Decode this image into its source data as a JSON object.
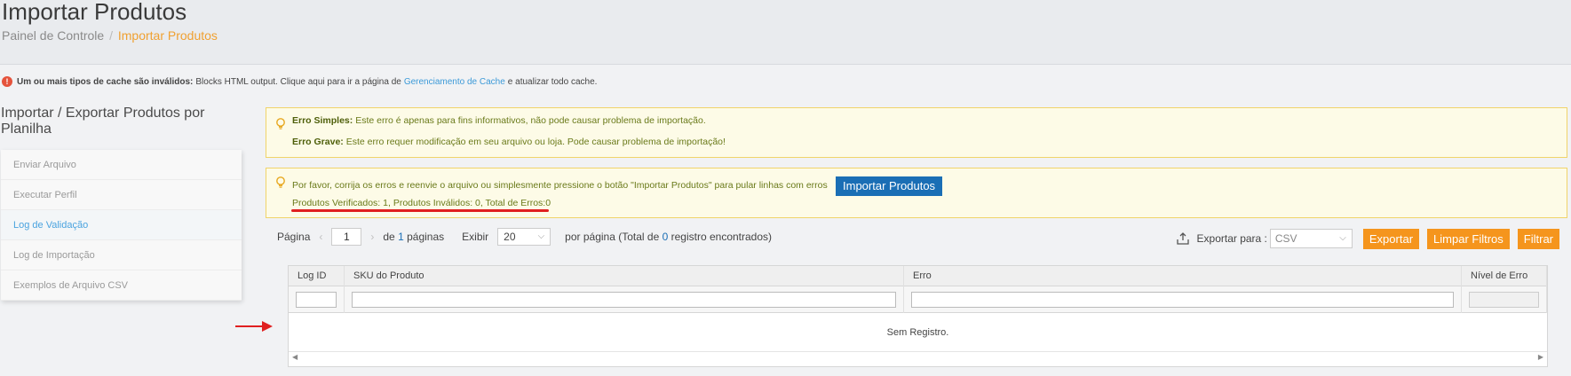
{
  "header": {
    "title": "Importar Produtos",
    "breadcrumb": {
      "home": "Painel de Controle",
      "separator": "/",
      "current": "Importar Produtos"
    }
  },
  "cache_notice": {
    "bold": "Um ou mais tipos de cache são inválidos:",
    "text": "Blocks HTML output. Clique aqui para ir a página de",
    "link": "Gerenciamento de Cache",
    "suffix": "e atualizar todo cache."
  },
  "sidebar": {
    "title": "Importar / Exportar Produtos por Planilha",
    "items": [
      {
        "label": "Enviar Arquivo"
      },
      {
        "label": "Executar Perfil"
      },
      {
        "label": "Log de Validação",
        "active": true
      },
      {
        "label": "Log de Importação"
      },
      {
        "label": "Exemplos de Arquivo CSV"
      }
    ]
  },
  "notice_errors": {
    "simple_label": "Erro Simples:",
    "simple_text": "Este erro é apenas para fins informativos, não pode causar problema de importação.",
    "grave_label": "Erro Grave:",
    "grave_text": "Este erro requer modificação em seu arquivo ou loja. Pode causar problema de importação!"
  },
  "notice_action": {
    "text": "Por favor, corrija os erros e reenvie o arquivo ou simplesmente pressione o botão \"Importar Produtos\" para pular linhas com erros",
    "button": "Importar Produtos",
    "summary": "Produtos Verificados: 1, Produtos Inválidos: 0, Total de Erros:0"
  },
  "pager": {
    "page_label": "Página",
    "page_value": "1",
    "of_label": "de",
    "total_pages": "1",
    "pages_label": "páginas",
    "show_label": "Exibir",
    "per_page": "20",
    "per_page_text": "por página (Total de",
    "total_records": "0",
    "records_text": "registro encontrados)"
  },
  "export": {
    "label": "Exportar para :",
    "format": "CSV",
    "export_button": "Exportar",
    "clear_button": "Limpar Filtros",
    "filter_button": "Filtrar"
  },
  "grid": {
    "columns": [
      "Log ID",
      "SKU do Produto",
      "Erro",
      "Nível de Erro"
    ],
    "empty_text": "Sem Registro."
  },
  "colors": {
    "accent_orange": "#f5951d",
    "primary_blue": "#1a6eb5",
    "link_blue": "#4aa3df",
    "annotation_red": "#e02020"
  }
}
